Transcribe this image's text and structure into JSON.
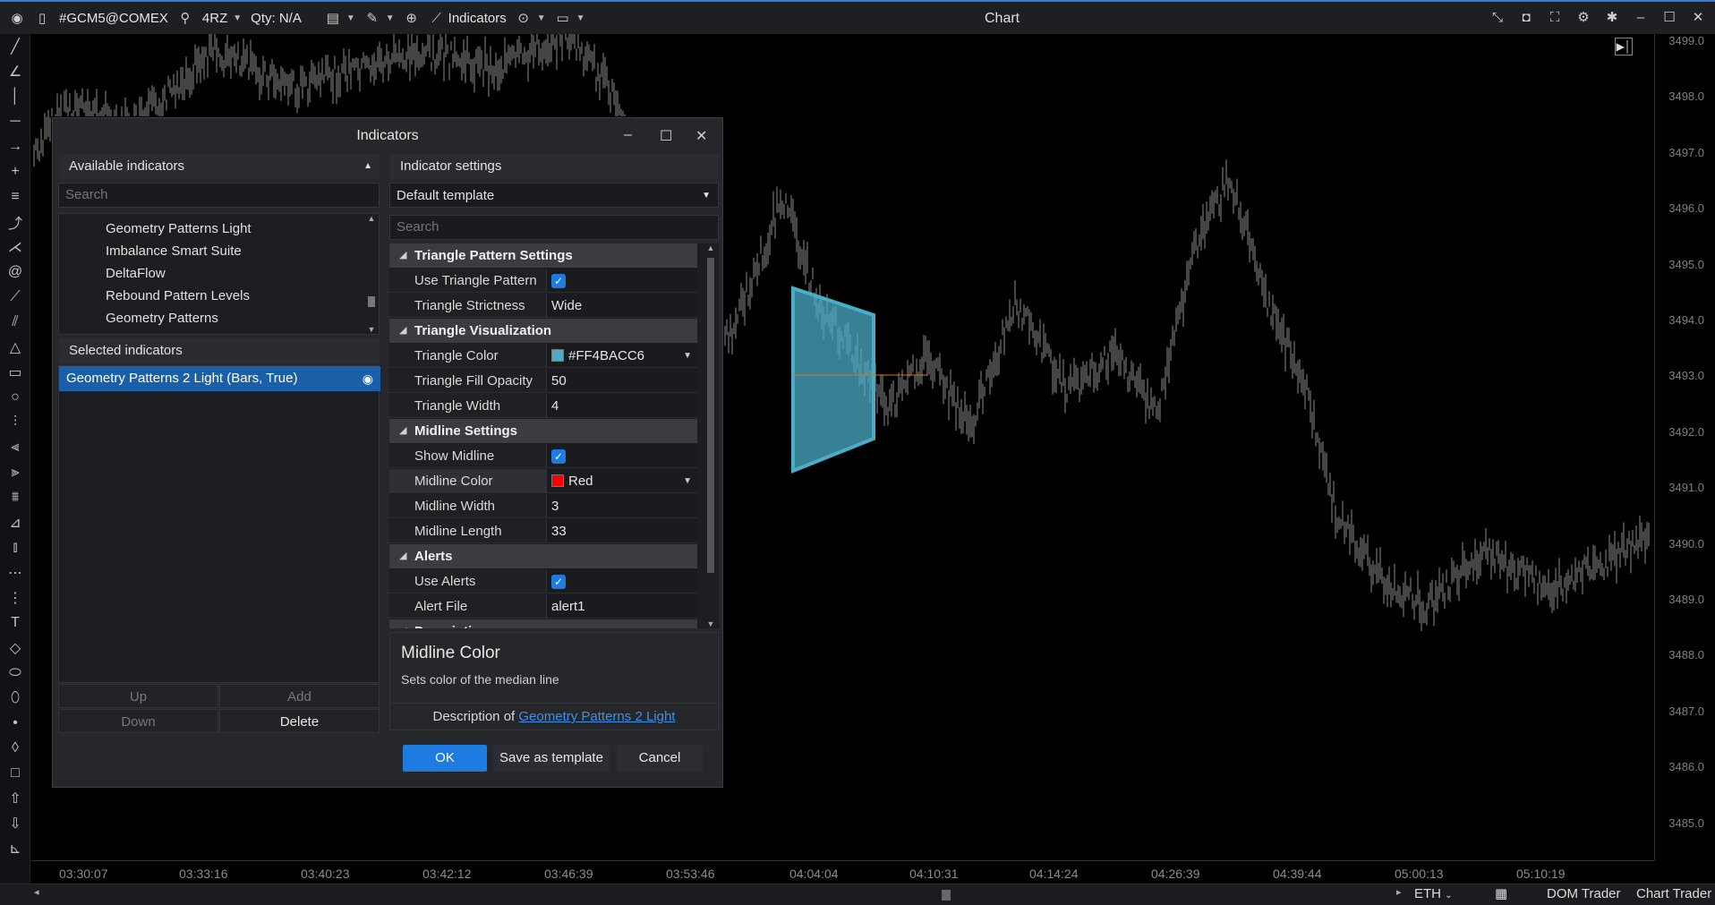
{
  "toolbar": {
    "symbol": "#GCM5@COMEX",
    "timeframe": "4RZ",
    "qty": "Qty: N/A",
    "indicators": "Indicators",
    "window_title": "Chart"
  },
  "yaxis": {
    "labels": [
      "3499.0",
      "3498.0",
      "3497.0",
      "3496.0",
      "3495.0",
      "3494.0",
      "3493.0",
      "3492.0",
      "3491.0",
      "3490.0",
      "3489.0",
      "3488.0",
      "3487.0",
      "3486.0",
      "3485.0"
    ]
  },
  "xaxis": {
    "labels": [
      "03:30:07",
      "03:33:16",
      "03:40:23",
      "03:42:12",
      "03:46:39",
      "03:53:46",
      "04:04:04",
      "04:10:31",
      "04:14:24",
      "04:26:39",
      "04:39:44",
      "05:00:13",
      "05:10:19"
    ]
  },
  "bottom": {
    "session": "ETH",
    "dom_trader": "DOM Trader",
    "chart_trader": "Chart Trader"
  },
  "dialog": {
    "title": "Indicators",
    "available_header": "Available indicators",
    "search_placeholder": "Search",
    "available_list": [
      "Geometry Patterns Light",
      "Imbalance Smart Suite",
      "DeltaFlow",
      "Rebound Pattern Levels",
      "Geometry Patterns"
    ],
    "selected_header": "Selected indicators",
    "selected_item": "Geometry Patterns 2 Light (Bars, True)",
    "buttons": {
      "up": "Up",
      "add": "Add",
      "down": "Down",
      "delete": "Delete",
      "ok": "OK",
      "save_template": "Save as template",
      "cancel": "Cancel"
    },
    "settings_header": "Indicator settings",
    "template": "Default template",
    "settings_search": "Search",
    "categories": {
      "triangle_pattern": "Triangle Pattern Settings",
      "triangle_vis": "Triangle Visualization",
      "midline": "Midline Settings",
      "alerts": "Alerts",
      "description": "Description"
    },
    "props": {
      "use_triangle": "Use Triangle Pattern",
      "triangle_strictness": "Triangle Strictness",
      "triangle_strictness_val": "Wide",
      "triangle_color": "Triangle Color",
      "triangle_color_val": "#FF4BACC6",
      "triangle_fill": "Triangle Fill Opacity",
      "triangle_fill_val": "50",
      "triangle_width": "Triangle Width",
      "triangle_width_val": "4",
      "show_midline": "Show Midline",
      "midline_color": "Midline Color",
      "midline_color_val": "Red",
      "midline_width": "Midline Width",
      "midline_width_val": "3",
      "midline_length": "Midline Length",
      "midline_length_val": "33",
      "use_alerts": "Use Alerts",
      "alert_file": "Alert File",
      "alert_file_val": "alert1"
    },
    "desc_title": "Midline Color",
    "desc_text": "Sets color of the median line",
    "desc_of": "Description of",
    "desc_link": "Geometry Patterns 2 Light"
  },
  "colors": {
    "accent": "#1e7ce0",
    "triangle": "#4BACC6",
    "midline": "#FF0000",
    "selected": "#1b5fa8"
  }
}
